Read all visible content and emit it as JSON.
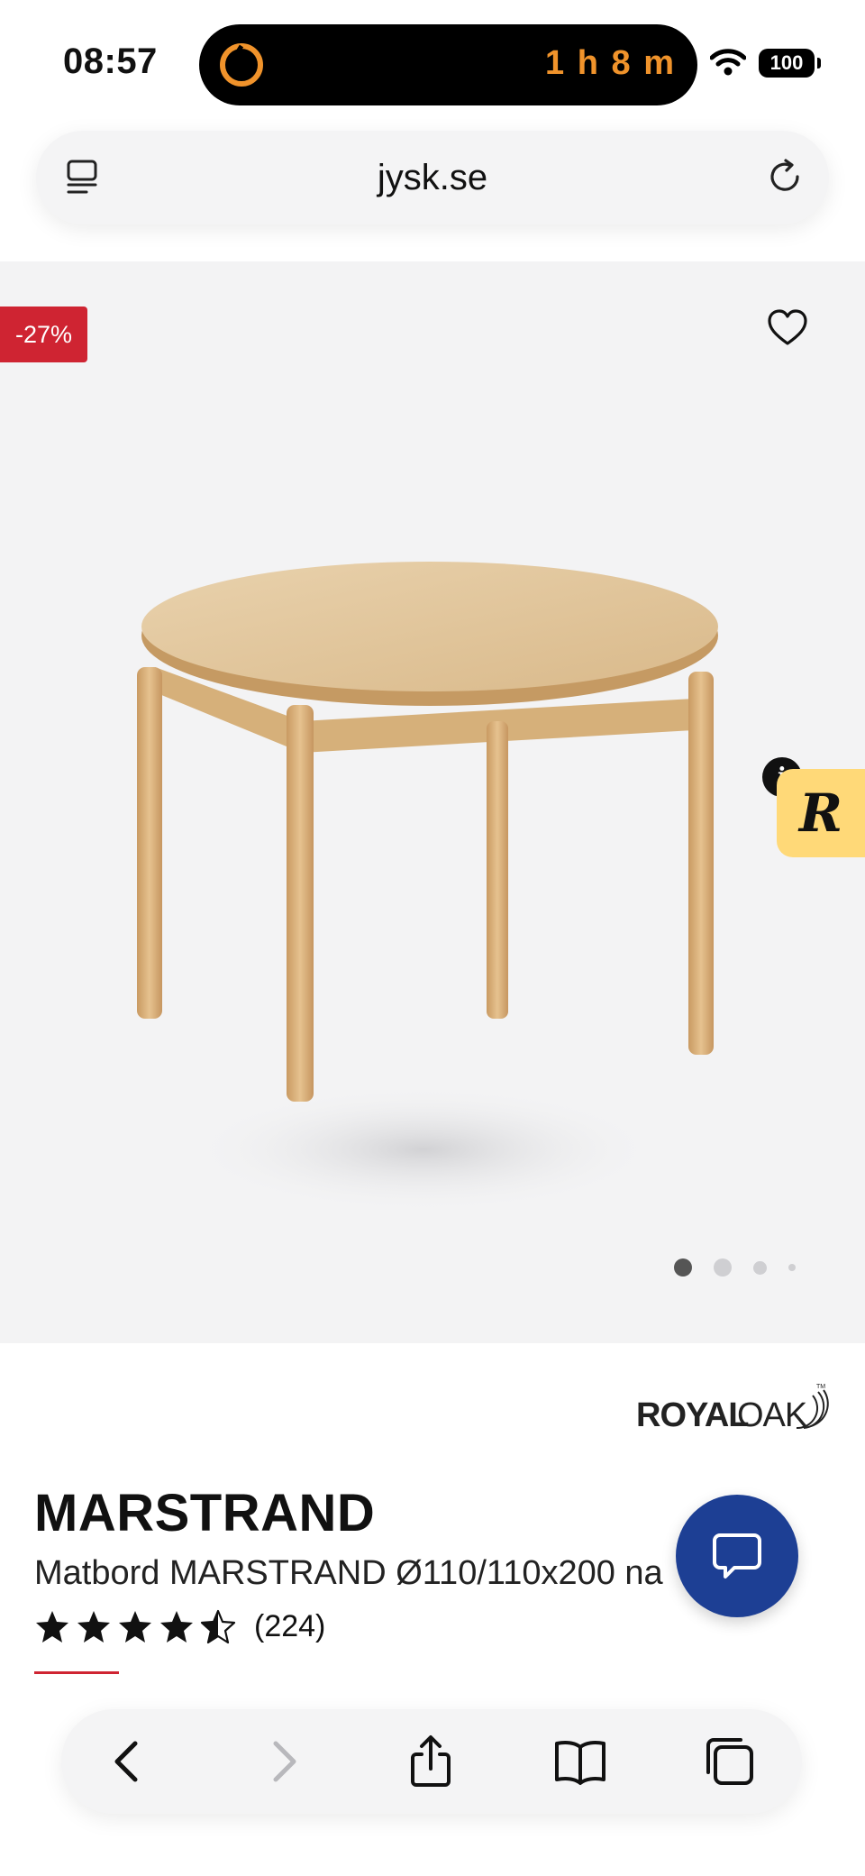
{
  "status_bar": {
    "time": "08:57",
    "activity_timer": "1 h 8 m",
    "battery": "100"
  },
  "browser": {
    "url": "jysk.se"
  },
  "product": {
    "discount_badge": "-27%",
    "brand_logo": "ROYALOAK",
    "name": "MARSTRAND",
    "description": "Matbord MARSTRAND Ø110/110x200 na",
    "rating_value": 4.5,
    "rating_count": "(224)",
    "image_dots": {
      "count": 4,
      "active_index": 0
    }
  },
  "colors": {
    "discount_red": "#cf2432",
    "chat_blue": "#1d3f94",
    "timer_orange": "#f0932b",
    "badge_yellow": "#ffd978"
  },
  "icons": {
    "tabs": "tabs-icon",
    "reload": "reload-icon",
    "favorite": "heart-icon",
    "chat": "chat-bubble-icon",
    "back": "chevron-left-icon",
    "forward": "chevron-right-icon",
    "share": "share-icon",
    "bookmarks": "book-icon",
    "tab_switcher": "tabs-copy-icon"
  }
}
